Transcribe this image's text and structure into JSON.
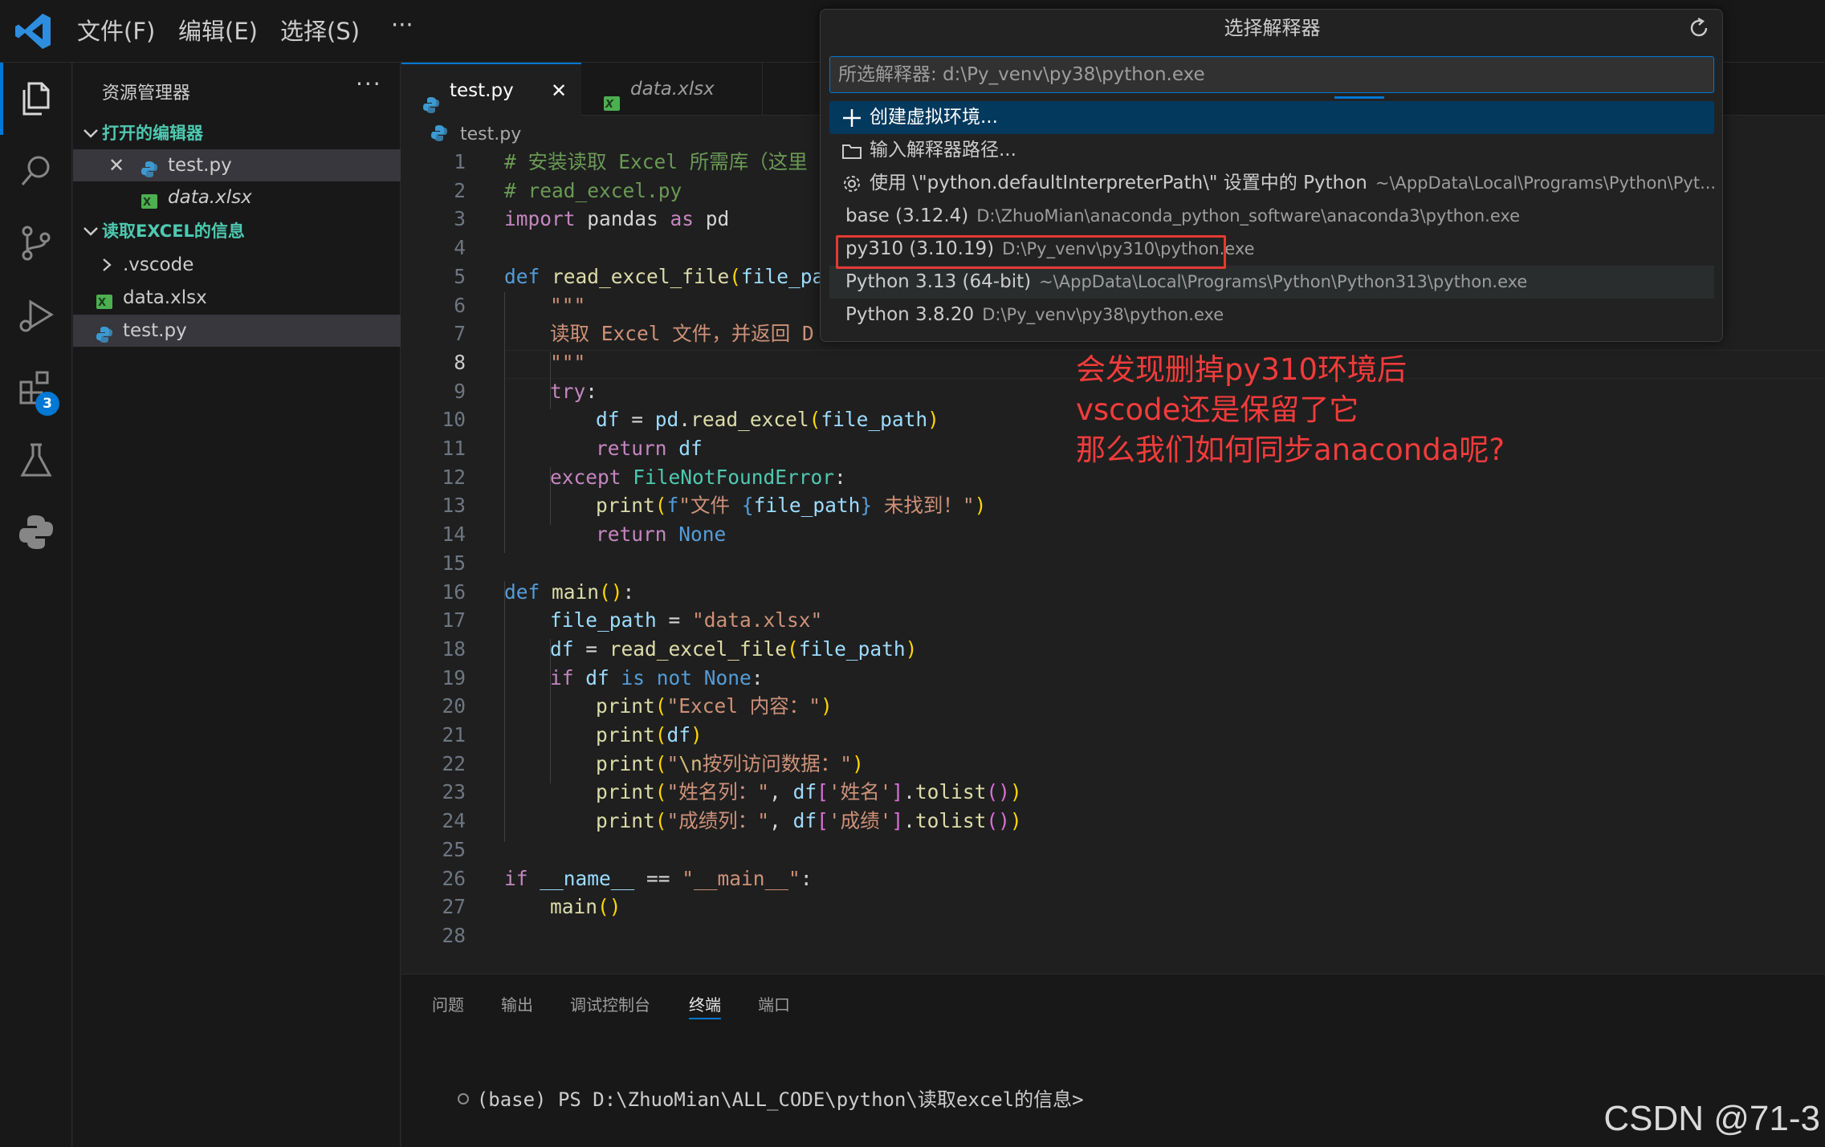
{
  "menu": {
    "file": "文件(F)",
    "edit": "编辑(E)",
    "select": "选择(S)",
    "more": "···"
  },
  "activity": {
    "extensions_badge": "3"
  },
  "sidebar": {
    "title": "资源管理器",
    "more": "···",
    "open_editors": {
      "header": "打开的编辑器",
      "items": [
        {
          "label": "test.py",
          "close": "✕"
        },
        {
          "label": "data.xlsx"
        }
      ]
    },
    "project": {
      "header": "读取EXCEL的信息",
      "items": [
        {
          "label": ".vscode"
        },
        {
          "label": "data.xlsx"
        },
        {
          "label": "test.py"
        }
      ]
    }
  },
  "tabs": [
    {
      "label": "test.py",
      "close": "✕"
    },
    {
      "label": "data.xlsx"
    }
  ],
  "breadcrumb": "test.py",
  "code_lines": [
    "1",
    "2",
    "3",
    "4",
    "5",
    "6",
    "7",
    "8",
    "9",
    "10",
    "11",
    "12",
    "13",
    "14",
    "15",
    "16",
    "17",
    "18",
    "19",
    "20",
    "21",
    "22",
    "23",
    "24",
    "25",
    "26",
    "27",
    "28"
  ],
  "code": {
    "l1": "# 安装读取 Excel 所需库（这里",
    "l2": "# read_excel.py",
    "l3a": "import",
    "l3b": " pandas ",
    "l3c": "as",
    "l3d": " pd",
    "l5a": "def",
    "l5b": " read_excel_file",
    "l5c": "(",
    "l5d": "file_pa",
    "l6": "\"\"\"",
    "l7": "读取 Excel 文件，并返回 D",
    "l8": "\"\"\"",
    "l9a": "try",
    "l9b": ":",
    "l10a": "df",
    "l10b": " = ",
    "l10c": "pd",
    "l10d": ".",
    "l10e": "read_excel",
    "l10f": "(",
    "l10g": "file_path",
    "l10h": ")",
    "l11a": "return",
    "l11b": " df",
    "l12a": "except",
    "l12b": " FileNotFoundError",
    "l12c": ":",
    "l13a": "print",
    "l13b": "(",
    "l13c": "f",
    "l13d": "\"文件 ",
    "l13e": "{",
    "l13f": "file_path",
    "l13g": "}",
    "l13h": " 未找到！\"",
    "l13i": ")",
    "l14a": "return",
    "l14b": " None",
    "l16a": "def",
    "l16b": " main",
    "l16c": "()",
    "l16d": ":",
    "l17a": "file_path",
    "l17b": " = ",
    "l17c": "\"data.xlsx\"",
    "l18a": "df",
    "l18b": " = ",
    "l18c": "read_excel_file",
    "l18d": "(",
    "l18e": "file_path",
    "l18f": ")",
    "l19a": "if",
    "l19b": " df ",
    "l19c": "is not",
    "l19d": " None",
    "l19e": ":",
    "l20a": "print",
    "l20b": "(",
    "l20c": "\"Excel 内容：\"",
    "l20d": ")",
    "l21a": "print",
    "l21b": "(",
    "l21c": "df",
    "l21d": ")",
    "l22a": "print",
    "l22b": "(",
    "l22c": "\"",
    "l22d": "\\n",
    "l22e": "按列访问数据：\"",
    "l22f": ")",
    "l23a": "print",
    "l23b": "(",
    "l23c": "\"姓名列：\"",
    "l23d": ", ",
    "l23e": "df",
    "l23f": "[",
    "l23g": "'姓名'",
    "l23h": "]",
    "l23i": ".",
    "l23j": "tolist",
    "l23k": "()",
    "l23l": ")",
    "l24a": "print",
    "l24b": "(",
    "l24c": "\"成绩列：\"",
    "l24d": ", ",
    "l24e": "df",
    "l24f": "[",
    "l24g": "'成绩'",
    "l24h": "]",
    "l24i": ".",
    "l24j": "tolist",
    "l24k": "()",
    "l24l": ")",
    "l26a": "if",
    "l26b": " __name__",
    "l26c": " == ",
    "l26d": "\"__main__\"",
    "l26e": ":",
    "l27a": "main",
    "l27b": "()"
  },
  "panel": {
    "tabs": [
      "问题",
      "输出",
      "调试控制台",
      "终端",
      "端口"
    ],
    "active_tab": "终端",
    "terminal_line": "(base) PS D:\\ZhuoMian\\ALL_CODE\\python\\读取excel的信息>"
  },
  "quick_pick": {
    "title": "选择解释器",
    "placeholder": "所选解释器: d:\\Py_venv\\py38\\python.exe",
    "items": [
      {
        "label": "创建虚拟环境...",
        "icon": "plus-icon"
      },
      {
        "label": "输入解释器路径...",
        "icon": "folder-icon"
      },
      {
        "label": "使用 \\\"python.defaultInterpreterPath\\\" 设置中的 Python",
        "desc": "~\\AppData\\Local\\Programs\\Python\\Pyt...",
        "icon": "gear-icon"
      },
      {
        "label": "base (3.12.4)",
        "desc": "D:\\ZhuoMian\\anaconda_python_software\\anaconda3\\python.exe"
      },
      {
        "label": "py310 (3.10.19)",
        "desc": "D:\\Py_venv\\py310\\python.exe"
      },
      {
        "label": "Python 3.13 (64-bit)",
        "desc": "~\\AppData\\Local\\Programs\\Python\\Python313\\python.exe"
      },
      {
        "label": "Python 3.8.20",
        "desc": "D:\\Py_venv\\py38\\python.exe"
      }
    ]
  },
  "annotation": {
    "line1": "会发现删掉py310环境后",
    "line2": "vscode还是保留了它",
    "line3": "那么我们如何同步anaconda呢?"
  },
  "watermark": "CSDN @71-3",
  "colors": {
    "accent": "#0078d4",
    "annotation_red": "#f23b3b",
    "highlight_box": "#e53935"
  }
}
